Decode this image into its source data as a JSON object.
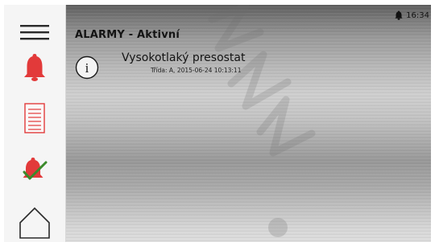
{
  "header": {
    "title": "ALARMY - Aktivní"
  },
  "status_bar": {
    "time": "16:34",
    "icon": "bell-icon"
  },
  "sidebar": {
    "items": [
      {
        "name": "menu",
        "icon": "hamburger-menu-icon",
        "color": "#2a2a2a"
      },
      {
        "name": "active-alarms",
        "icon": "bell-icon",
        "color": "#e23a3a",
        "active": true
      },
      {
        "name": "alarm-history",
        "icon": "document-list-icon",
        "color": "#e23a3a"
      },
      {
        "name": "acknowledged-alarms",
        "icon": "bell-check-icon",
        "color": "#e23a3a"
      },
      {
        "name": "home",
        "icon": "home-icon",
        "color": "#2a2a2a"
      }
    ]
  },
  "alarms": [
    {
      "icon": "info-icon",
      "name": "Vysokotlaký presostat",
      "meta": "Třída: A, 2015-06-24 10:13:11"
    }
  ],
  "colors": {
    "accent": "#e23a3a",
    "check": "#3a8a2a",
    "sidebar_bg": "#f5f5f5"
  }
}
